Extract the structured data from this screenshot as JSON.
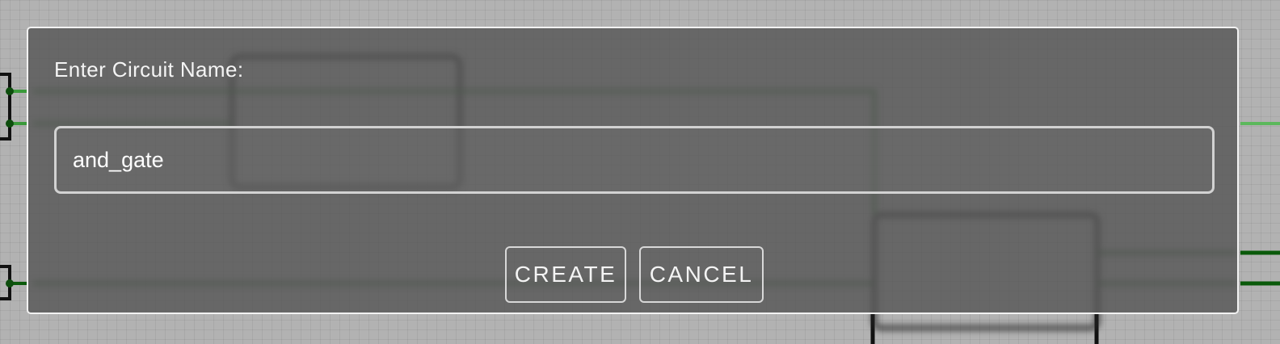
{
  "dialog": {
    "title": "Enter Circuit Name:",
    "input_value": "and_gate",
    "create_label": "CREATE",
    "cancel_label": "CANCEL"
  },
  "colors": {
    "grid_background": "#b2b2b2",
    "wire_on": "#2e8b2e",
    "wire_dark": "#0a5a0a",
    "wire_black": "#111111",
    "dialog_bg": "rgba(84,84,84,0.8)",
    "dialog_border": "#f2f2f2"
  }
}
